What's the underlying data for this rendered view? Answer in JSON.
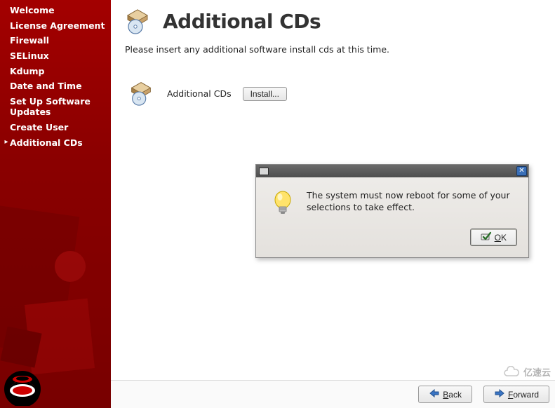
{
  "sidebar": {
    "items": [
      {
        "label": "Welcome",
        "active": false
      },
      {
        "label": "License Agreement",
        "active": false
      },
      {
        "label": "Firewall",
        "active": false
      },
      {
        "label": "SELinux",
        "active": false
      },
      {
        "label": "Kdump",
        "active": false
      },
      {
        "label": "Date and Time",
        "active": false
      },
      {
        "label": "Set Up Software Updates",
        "active": false
      },
      {
        "label": "Create User",
        "active": false
      },
      {
        "label": "Additional CDs",
        "active": true
      }
    ]
  },
  "page": {
    "title": "Additional CDs",
    "intro": "Please insert any additional software install cds at this time."
  },
  "cd_section": {
    "label": "Additional CDs",
    "install_button": "Install..."
  },
  "dialog": {
    "message": "The system must now reboot for some of your selections to take effect.",
    "ok_mnemonic": "O",
    "ok_rest": "K"
  },
  "footer": {
    "back_mnemonic": "B",
    "back_rest": "ack",
    "forward_mnemonic": "F",
    "forward_rest": "orward"
  },
  "watermark": {
    "text": "亿速云"
  }
}
